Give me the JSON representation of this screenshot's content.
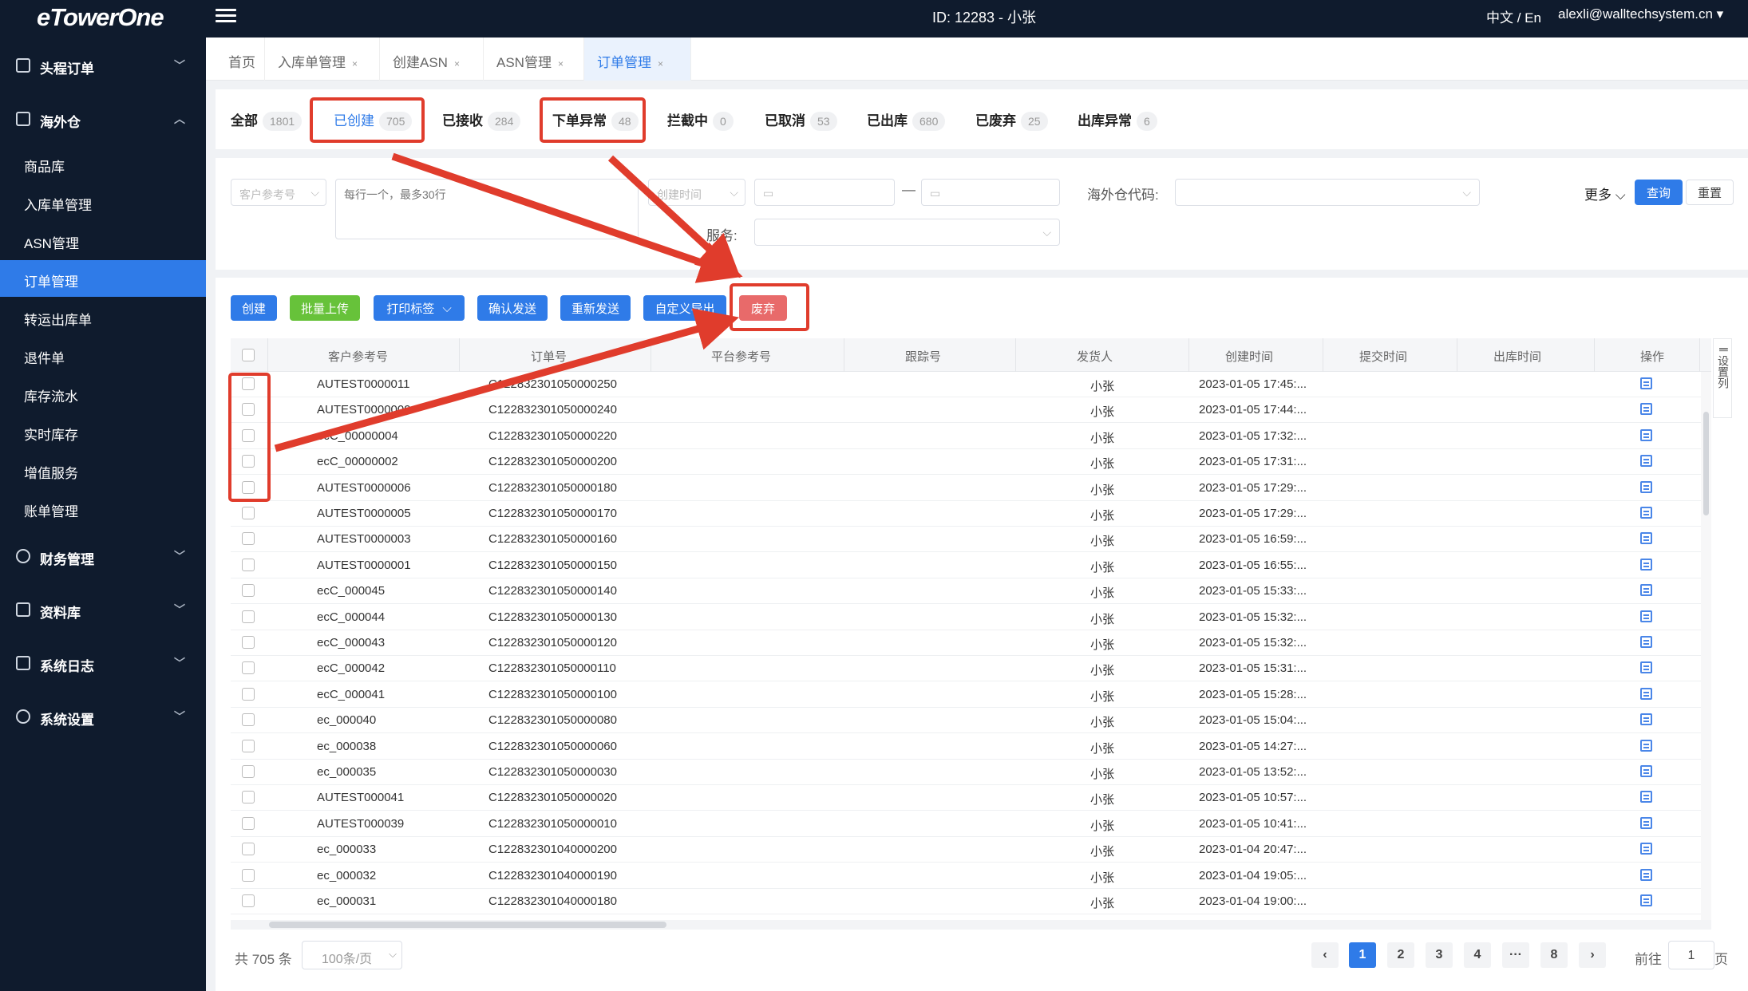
{
  "topbar": {
    "logo": "eTowerOne",
    "id_text": "ID: 12283 - 小张",
    "lang": "中文 / En",
    "user": "alexli@walltechsystem.cn ▾"
  },
  "sidebar": {
    "groups": [
      {
        "label": "头程订单",
        "chev": "﹀"
      },
      {
        "label": "海外仓",
        "chev": "︿"
      },
      {
        "label": "财务管理",
        "chev": "﹀"
      },
      {
        "label": "资料库",
        "chev": "﹀"
      },
      {
        "label": "系统日志",
        "chev": "﹀"
      },
      {
        "label": "系统设置",
        "chev": "﹀"
      }
    ],
    "items": [
      "商品库",
      "入库单管理",
      "ASN管理",
      "订单管理",
      "转运出库单",
      "退件单",
      "库存流水",
      "实时库存",
      "增值服务",
      "账单管理"
    ]
  },
  "tabs": [
    "首页",
    "入库单管理",
    "创建ASN",
    "ASN管理",
    "订单管理"
  ],
  "tab_close": "×",
  "statuses": [
    {
      "label": "全部",
      "count": "1801"
    },
    {
      "label": "已创建",
      "count": "705"
    },
    {
      "label": "已接收",
      "count": "284"
    },
    {
      "label": "下单异常",
      "count": "48"
    },
    {
      "label": "拦截中",
      "count": "0"
    },
    {
      "label": "已取消",
      "count": "53"
    },
    {
      "label": "已出库",
      "count": "680"
    },
    {
      "label": "已废弃",
      "count": "25"
    },
    {
      "label": "出库异常",
      "count": "6"
    }
  ],
  "filter": {
    "ref_select": "客户参考号",
    "ref_placeholder": "每行一个，最多30行",
    "time_select": "创建时间",
    "dash": "—",
    "warehouse_label": "海外仓代码:",
    "service_label": "服务:",
    "more": "更多",
    "query": "查询",
    "reset": "重置"
  },
  "actions": {
    "create": "创建",
    "batch_upload": "批量上传",
    "print_label": "打印标签",
    "confirm_send": "确认发送",
    "resend": "重新发送",
    "custom_export": "自定义导出",
    "discard": "废弃"
  },
  "table": {
    "headers": [
      "客户参考号",
      "订单号",
      "平台参考号",
      "跟踪号",
      "发货人",
      "创建时间",
      "提交时间",
      "出库时间",
      "操作"
    ],
    "settings": "设置列",
    "rows": [
      [
        "AUTEST0000011",
        "C122832301050000250",
        "小张",
        "2023-01-05 17:45:..."
      ],
      [
        "AUTEST0000009",
        "C122832301050000240",
        "小张",
        "2023-01-05 17:44:..."
      ],
      [
        "ecC_00000004",
        "C122832301050000220",
        "小张",
        "2023-01-05 17:32:..."
      ],
      [
        "ecC_00000002",
        "C122832301050000200",
        "小张",
        "2023-01-05 17:31:..."
      ],
      [
        "AUTEST0000006",
        "C122832301050000180",
        "小张",
        "2023-01-05 17:29:..."
      ],
      [
        "AUTEST0000005",
        "C122832301050000170",
        "小张",
        "2023-01-05 17:29:..."
      ],
      [
        "AUTEST0000003",
        "C122832301050000160",
        "小张",
        "2023-01-05 16:59:..."
      ],
      [
        "AUTEST0000001",
        "C122832301050000150",
        "小张",
        "2023-01-05 16:55:..."
      ],
      [
        "ecC_000045",
        "C122832301050000140",
        "小张",
        "2023-01-05 15:33:..."
      ],
      [
        "ecC_000044",
        "C122832301050000130",
        "小张",
        "2023-01-05 15:32:..."
      ],
      [
        "ecC_000043",
        "C122832301050000120",
        "小张",
        "2023-01-05 15:32:..."
      ],
      [
        "ecC_000042",
        "C122832301050000110",
        "小张",
        "2023-01-05 15:31:..."
      ],
      [
        "ecC_000041",
        "C122832301050000100",
        "小张",
        "2023-01-05 15:28:..."
      ],
      [
        "ec_000040",
        "C122832301050000080",
        "小张",
        "2023-01-05 15:04:..."
      ],
      [
        "ec_000038",
        "C122832301050000060",
        "小张",
        "2023-01-05 14:27:..."
      ],
      [
        "ec_000035",
        "C122832301050000030",
        "小张",
        "2023-01-05 13:52:..."
      ],
      [
        "AUTEST000041",
        "C122832301050000020",
        "小张",
        "2023-01-05 10:57:..."
      ],
      [
        "AUTEST000039",
        "C122832301050000010",
        "小张",
        "2023-01-05 10:41:..."
      ],
      [
        "ec_000033",
        "C122832301040000200",
        "小张",
        "2023-01-04 20:47:..."
      ],
      [
        "ec_000032",
        "C122832301040000190",
        "小张",
        "2023-01-04 19:05:..."
      ],
      [
        "ec_000031",
        "C122832301040000180",
        "小张",
        "2023-01-04 19:00:..."
      ]
    ]
  },
  "pagination": {
    "total": "共 705 条",
    "page_size": "100条/页",
    "pages": [
      "1",
      "2",
      "3",
      "4",
      "···",
      "8"
    ],
    "prev": "‹",
    "next": "›",
    "goto_label": "前往",
    "goto_value": "1",
    "goto_suffix": "页"
  },
  "colors": {
    "primary": "#2f7be8",
    "green": "#67c23a",
    "danger": "#e86a6a",
    "annotation": "#e03c2c",
    "sidebar": "#0f1b2d"
  }
}
